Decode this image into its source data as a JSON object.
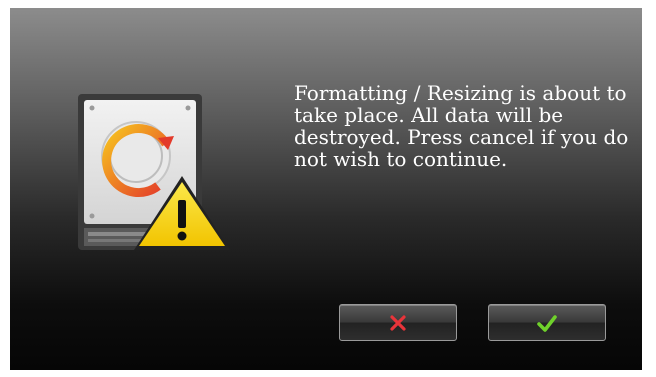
{
  "dialog": {
    "message": "Formatting / Resizing is about to take place. All data will be destroyed. Press cancel if you do not wish to continue.",
    "icon": "hard-drive-warning-icon",
    "buttons": {
      "cancel_icon": "cross-icon",
      "confirm_icon": "checkmark-icon"
    }
  },
  "colors": {
    "cancel_icon": "#e8343a",
    "confirm_icon": "#6fd12b",
    "warning": "#f5d40a",
    "progress_arc_start": "#f7c51f",
    "progress_arc_end": "#e33a2a"
  }
}
